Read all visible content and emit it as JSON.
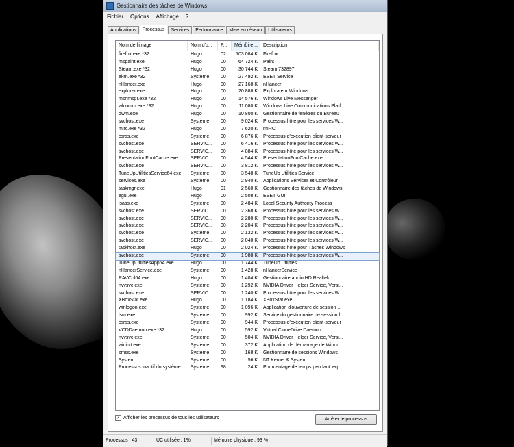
{
  "window": {
    "title": "Gestionnaire des tâches de Windows"
  },
  "menu": [
    "Fichier",
    "Options",
    "Affichage",
    "?"
  ],
  "tabs": [
    {
      "label": "Applications",
      "active": false
    },
    {
      "label": "Processus",
      "active": true
    },
    {
      "label": "Services",
      "active": false
    },
    {
      "label": "Performance",
      "active": false
    },
    {
      "label": "Mise en réseau",
      "active": false
    },
    {
      "label": "Utilisateurs",
      "active": false
    }
  ],
  "columns": [
    "Nom de l'image",
    "Nom d'u...",
    "P...",
    "Mémoire ...",
    "Description"
  ],
  "rows": [
    [
      "firefox.exe *32",
      "Hugo",
      "02",
      "103 084 K",
      "Firefox"
    ],
    [
      "mspaint.exe",
      "Hugo",
      "00",
      "64 724 K",
      "Paint"
    ],
    [
      "Steam.exe *32",
      "Hugo",
      "00",
      "30 744 K",
      "Steam 732897"
    ],
    [
      "ekrn.exe *32",
      "Système",
      "00",
      "27 492 K",
      "ESET Service"
    ],
    [
      "nHancer.exe",
      "Hugo",
      "00",
      "27 168 K",
      "nHancer"
    ],
    [
      "explorer.exe",
      "Hugo",
      "00",
      "20 888 K",
      "Explorateur Windows"
    ],
    [
      "msnmsgr.exe *32",
      "Hugo",
      "00",
      "14 576 K",
      "Windows Live Messenger"
    ],
    [
      "wlcomm.exe *32",
      "Hugo",
      "00",
      "11 080 K",
      "Windows Live Communications Platf..."
    ],
    [
      "dwm.exe",
      "Hugo",
      "00",
      "10 800 K",
      "Gestionnaire de fenêtres du Bureau"
    ],
    [
      "svchost.exe",
      "Système",
      "00",
      "9 024 K",
      "Processus hôte pour les services W..."
    ],
    [
      "mirc.exe *32",
      "Hugo",
      "00",
      "7 620 K",
      "mIRC"
    ],
    [
      "csrss.exe",
      "Système",
      "00",
      "6 876 K",
      "Processus d'exécution client-serveur"
    ],
    [
      "svchost.exe",
      "SERVIC...",
      "00",
      "6 416 K",
      "Processus hôte pour les services W..."
    ],
    [
      "svchost.exe",
      "SERVIC...",
      "00",
      "4 884 K",
      "Processus hôte pour les services W..."
    ],
    [
      "PresentationFontCache.exe",
      "SERVIC...",
      "00",
      "4 544 K",
      "PresentationFontCache.exe"
    ],
    [
      "svchost.exe",
      "SERVIC...",
      "00",
      "3 812 K",
      "Processus hôte pour les services W..."
    ],
    [
      "TuneUpUtilitiesService64.exe",
      "Système",
      "00",
      "3 548 K",
      "TuneUp Utilities Service"
    ],
    [
      "services.exe",
      "Système",
      "00",
      "2 940 K",
      "Applications Services et Contrôleur"
    ],
    [
      "taskmgr.exe",
      "Hugo",
      "01",
      "2 560 K",
      "Gestionnaire des tâches de Windows"
    ],
    [
      "egui.exe",
      "Hugo",
      "00",
      "2 508 K",
      "ESET GUI"
    ],
    [
      "lsass.exe",
      "Système",
      "00",
      "2 484 K",
      "Local Security Authority Process"
    ],
    [
      "svchost.exe",
      "SERVIC...",
      "00",
      "2 368 K",
      "Processus hôte pour les services W..."
    ],
    [
      "svchost.exe",
      "SERVIC...",
      "00",
      "2 280 K",
      "Processus hôte pour les services W..."
    ],
    [
      "svchost.exe",
      "SERVIC...",
      "00",
      "2 204 K",
      "Processus hôte pour les services W..."
    ],
    [
      "svchost.exe",
      "Système",
      "00",
      "2 132 K",
      "Processus hôte pour les services W..."
    ],
    [
      "svchost.exe",
      "SERVIC...",
      "00",
      "2 040 K",
      "Processus hôte pour les services W..."
    ],
    [
      "taskhost.exe",
      "Hugo",
      "00",
      "2 024 K",
      "Processus hôte pour Tâches Windows"
    ],
    [
      "svchost.exe",
      "Système",
      "00",
      "1 988 K",
      "Processus hôte pour les services W..."
    ],
    [
      "TuneUpUtilitiesApp64.exe",
      "Hugo",
      "00",
      "1 744 K",
      "TuneUp Utilities"
    ],
    [
      "nHancerService.exe",
      "Système",
      "00",
      "1 428 K",
      "nHancerService"
    ],
    [
      "RAVCpl64.exe",
      "Hugo",
      "00",
      "1 404 K",
      "Gestionnaire audio HD Realtek"
    ],
    [
      "nvvsvc.exe",
      "Système",
      "00",
      "1 292 K",
      "NVIDIA Driver Helper Service, Versi..."
    ],
    [
      "svchost.exe",
      "SERVIC...",
      "00",
      "1 240 K",
      "Processus hôte pour les services W..."
    ],
    [
      "XBoxStat.exe",
      "Hugo",
      "00",
      "1 184 K",
      "XBoxStat.exe"
    ],
    [
      "winlogon.exe",
      "Système",
      "00",
      "1 096 K",
      "Application d'ouverture de session ..."
    ],
    [
      "lsm.exe",
      "Système",
      "00",
      "992 K",
      "Service du gestionnaire de session l..."
    ],
    [
      "csrss.exe",
      "Système",
      "00",
      "944 K",
      "Processus d'exécution client-serveur"
    ],
    [
      "VCDDaemon.exe *32",
      "Hugo",
      "00",
      "592 K",
      "Virtual CloneDrive Daemon"
    ],
    [
      "nvvsvc.exe",
      "Système",
      "00",
      "504 K",
      "NVIDIA Driver Helper Service, Versi..."
    ],
    [
      "wininit.exe",
      "Système",
      "00",
      "372 K",
      "Application de démarrage de Windo..."
    ],
    [
      "smss.exe",
      "Système",
      "00",
      "168 K",
      "Gestionnaire de sessions Windows"
    ],
    [
      "System",
      "Système",
      "00",
      "56 K",
      "NT Kernel & System"
    ],
    [
      "Processus inactif du système",
      "Système",
      "98",
      "24 K",
      "Pourcentage de temps pendant leq..."
    ]
  ],
  "selected_row": 27,
  "show_all_label": "Afficher les processus de tous les utilisateurs",
  "show_all_checked": "✓",
  "end_process_label": "Arrêter le processus",
  "status": {
    "processes": "Processus : 43",
    "cpu": "UC utilisée : 1%",
    "memory": "Mémoire physique : 93 %"
  }
}
